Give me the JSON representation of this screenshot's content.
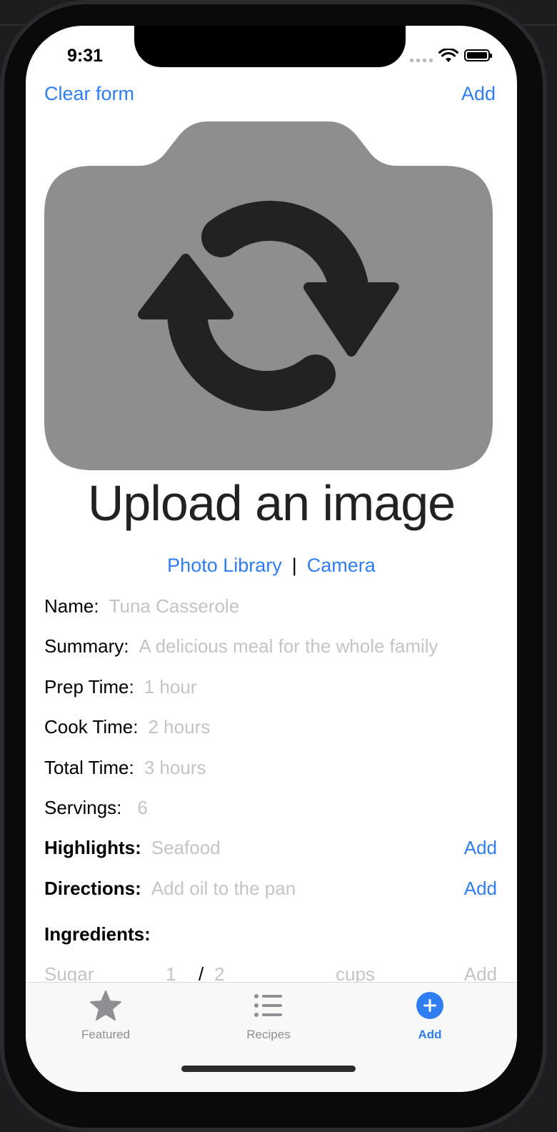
{
  "status_bar": {
    "time": "9:31"
  },
  "nav": {
    "clear_form": "Clear form",
    "add": "Add"
  },
  "image_upload": {
    "icon": "camera-rotate-icon",
    "title": "Upload an image",
    "photo_library": "Photo Library",
    "separator": "|",
    "camera": "Camera"
  },
  "form": {
    "name": {
      "label": "Name:",
      "placeholder": "Tuna Casserole"
    },
    "summary": {
      "label": "Summary:",
      "placeholder": "A delicious meal for the whole family"
    },
    "prep_time": {
      "label": "Prep Time:",
      "placeholder": "1 hour"
    },
    "cook_time": {
      "label": "Cook Time:",
      "placeholder": "2 hours"
    },
    "total_time": {
      "label": "Total Time:",
      "placeholder": "3 hours"
    },
    "servings": {
      "label": "Servings:",
      "placeholder": "6"
    },
    "highlights": {
      "label": "Highlights:",
      "placeholder": "Seafood",
      "add": "Add"
    },
    "directions": {
      "label": "Directions:",
      "placeholder": "Add oil to the pan",
      "add": "Add"
    },
    "ingredients": {
      "label": "Ingredients:",
      "name_placeholder": "Sugar",
      "numerator_placeholder": "1",
      "slash": "/",
      "denominator_placeholder": "2",
      "unit_placeholder": "cups",
      "add": "Add"
    }
  },
  "tabbar": {
    "tabs": [
      {
        "label": "Featured",
        "icon": "star-icon",
        "active": false
      },
      {
        "label": "Recipes",
        "icon": "list-icon",
        "active": false
      },
      {
        "label": "Add",
        "icon": "plus-circle-icon",
        "active": true
      }
    ]
  },
  "colors": {
    "accent": "#2f7df0",
    "placeholder": "#c4c4c6",
    "camera_body": "#8e8e8e",
    "camera_arrows": "#222222"
  }
}
